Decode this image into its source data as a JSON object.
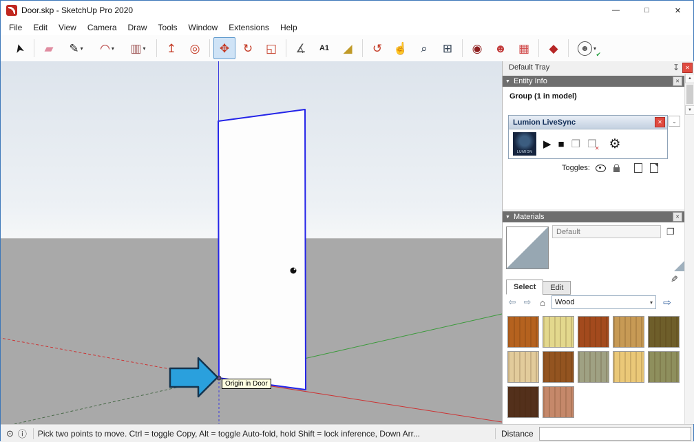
{
  "window": {
    "title": "Door.skp - SketchUp Pro 2020"
  },
  "icons": {
    "minimize": "—",
    "maximize": "□",
    "close": "✕",
    "pin": "↧",
    "collapse": "▼",
    "chevron_down": "⌄",
    "scroll_up": "▲",
    "scroll_down": "▼",
    "play": "▶",
    "stop": "■",
    "sync": "❒",
    "gear": "⚙",
    "back": "⇦",
    "forward": "⇨",
    "home": "⌂",
    "arrow_right": "⇨",
    "eyedropper": "✎",
    "secondary_pane": "❐",
    "geo": "⊙",
    "info": "ⓘ",
    "dropdown": "▾"
  },
  "menubar": {
    "items": [
      {
        "label": "File"
      },
      {
        "label": "Edit"
      },
      {
        "label": "View"
      },
      {
        "label": "Camera"
      },
      {
        "label": "Draw"
      },
      {
        "label": "Tools"
      },
      {
        "label": "Window"
      },
      {
        "label": "Extensions"
      },
      {
        "label": "Help"
      }
    ]
  },
  "toolbar": {
    "items": [
      {
        "name": "select-tool",
        "glyph": "➤",
        "color": "#1a1a1a"
      },
      {
        "sep": true
      },
      {
        "name": "eraser-tool",
        "glyph": "▰",
        "color": "#e08ca0"
      },
      {
        "name": "line-tool",
        "glyph": "✎",
        "color": "#2a2a2a",
        "dropdown": true
      },
      {
        "name": "arc-tool",
        "glyph": "◠",
        "color": "#b03030",
        "dropdown": true
      },
      {
        "name": "shapes-tool",
        "glyph": "▥",
        "color": "#a05858",
        "dropdown": true
      },
      {
        "sep": true
      },
      {
        "name": "pushpull-tool",
        "glyph": "↥",
        "color": "#c43a25"
      },
      {
        "name": "offset-tool",
        "glyph": "◎",
        "color": "#c43a25"
      },
      {
        "sep": true
      },
      {
        "name": "move-tool",
        "glyph": "✥",
        "color": "#c43a25",
        "active": true
      },
      {
        "name": "rotate-tool",
        "glyph": "↻",
        "color": "#c43a25"
      },
      {
        "name": "scale-tool",
        "glyph": "◱",
        "color": "#c43a25"
      },
      {
        "sep": true
      },
      {
        "name": "tape-measure-tool",
        "glyph": "∡",
        "color": "#555555"
      },
      {
        "name": "text-tool",
        "glyph": "A1",
        "color": "#222222",
        "small": true
      },
      {
        "name": "paint-bucket-tool",
        "glyph": "◢",
        "color": "#c09a28"
      },
      {
        "sep": true
      },
      {
        "name": "orbit-tool",
        "glyph": "↺",
        "color": "#c43a25"
      },
      {
        "name": "pan-tool",
        "glyph": "☝",
        "color": "#c8962a"
      },
      {
        "name": "zoom-tool",
        "glyph": "⌕",
        "color": "#2e3e50"
      },
      {
        "name": "zoom-extents-tool",
        "glyph": "⊞",
        "color": "#2e3e50"
      },
      {
        "sep": true
      },
      {
        "name": "extension-button-1",
        "glyph": "◉",
        "color": "#8e1f1f"
      },
      {
        "name": "extension-button-2",
        "glyph": "☻",
        "color": "#c23a3a"
      },
      {
        "name": "extension-button-3",
        "glyph": "▦",
        "color": "#d04848"
      },
      {
        "sep": true
      },
      {
        "name": "extension-button-4",
        "glyph": "◆",
        "color": "#b62626"
      },
      {
        "sep": true
      },
      {
        "name": "account-button",
        "glyph": "☻",
        "color": "#5a5a5a",
        "dropdown": true,
        "check": true
      }
    ]
  },
  "viewport": {
    "tooltip": "Origin in Door"
  },
  "tray": {
    "title": "Default Tray",
    "entity_info": {
      "title": "Entity Info",
      "summary": "Group (1 in model)"
    },
    "lumion": {
      "title": "Lumion LiveSync",
      "logo_text": "LUMION",
      "toggles_label": "Toggles:"
    },
    "materials": {
      "title": "Materials",
      "name_value": "Default",
      "collection": "Wood",
      "tabs": [
        {
          "label": "Select",
          "active": true
        },
        {
          "label": "Edit"
        }
      ],
      "swatches": [
        {
          "name": "wood-cherry",
          "color": "#b5621f"
        },
        {
          "name": "wood-light-maple",
          "color": "#e3d88d"
        },
        {
          "name": "wood-mahogany",
          "color": "#a34a1d"
        },
        {
          "name": "wood-oak-boards",
          "color": "#c79a55"
        },
        {
          "name": "wood-dark-olive",
          "color": "#6e5e2a"
        },
        {
          "name": "wood-parquet-light",
          "color": "#e2cb9b"
        },
        {
          "name": "wood-herringbone",
          "color": "#935420"
        },
        {
          "name": "wood-driftwood-gray",
          "color": "#9fa183"
        },
        {
          "name": "wood-bamboo-light",
          "color": "#eac878"
        },
        {
          "name": "wood-moss",
          "color": "#8e8f5d"
        },
        {
          "name": "wood-walnut-dark",
          "color": "#53301b"
        },
        {
          "name": "wood-rosewood-salmon",
          "color": "#c5886a"
        }
      ]
    }
  },
  "statusbar": {
    "hint": "Pick two points to move.  Ctrl = toggle Copy, Alt = toggle Auto-fold, hold Shift = lock inference, Down Arr...",
    "measurement_label": "Distance",
    "measurement_value": ""
  }
}
